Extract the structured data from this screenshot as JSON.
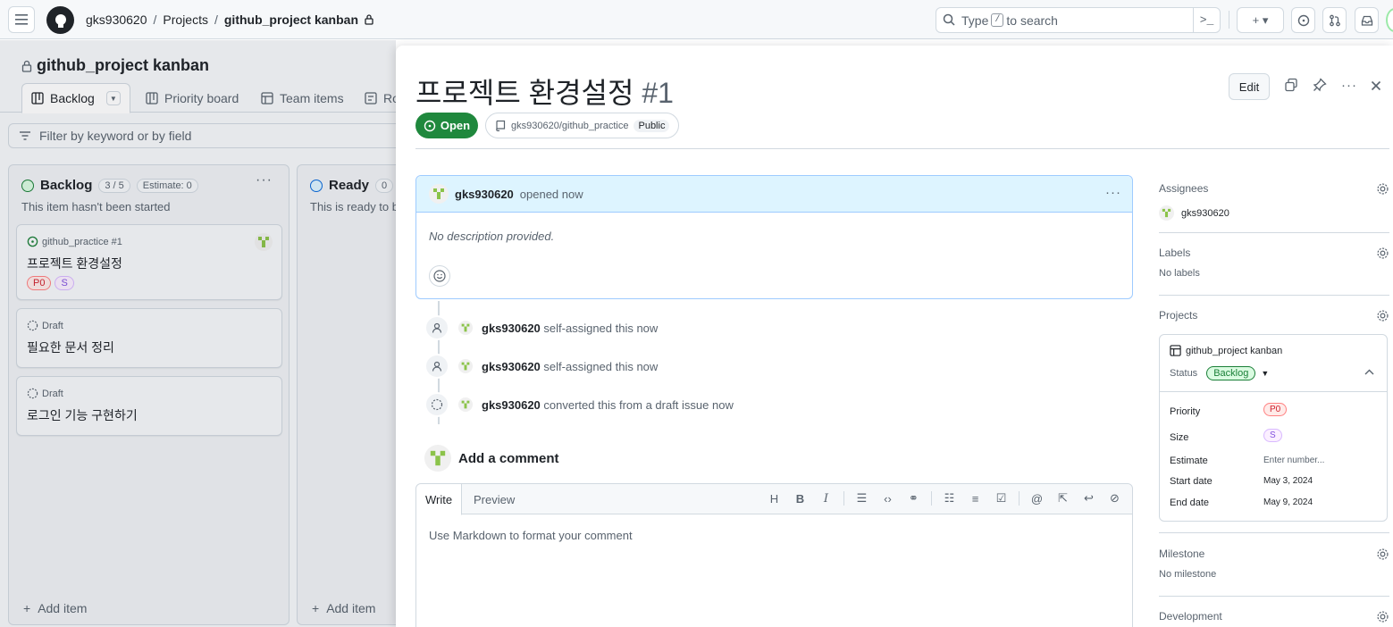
{
  "header": {
    "crumbs": [
      "gks930620",
      "Projects",
      "github_project kanban"
    ],
    "search_prefix": "Type",
    "search_key": "/",
    "search_suffix": "to search",
    "cmd": ">_",
    "plus": "+ ▾"
  },
  "project": {
    "title": "github_project kanban",
    "views": [
      "Backlog",
      "Priority board",
      "Team items",
      "Ro"
    ],
    "filter_placeholder": "Filter by keyword or by field"
  },
  "columns": [
    {
      "name": "Backlog",
      "count": "3 / 5",
      "estimate": "Estimate: 0",
      "desc": "This item hasn't been started",
      "color": "#1a7f37",
      "cards": [
        {
          "meta": "github_practice #1",
          "title": "프로젝트 환경설정",
          "labels": [
            "P0",
            "S"
          ]
        },
        {
          "meta": "Draft",
          "title": "필요한 문서 정리"
        },
        {
          "meta": "Draft",
          "title": "로그인 기능 구현하기"
        }
      ],
      "add_item": "Add item"
    },
    {
      "name": "Ready",
      "count": "0",
      "desc": "This is ready to b",
      "color": "#0969da",
      "add_item": "Add item"
    }
  ],
  "issue": {
    "title": "프로젝트 환경설정",
    "number": "#1",
    "edit": "Edit",
    "state": "Open",
    "repo": "gks930620/github_practice",
    "visibility": "Public",
    "author": "gks930620",
    "opened": "opened now",
    "body": "No description provided.",
    "timeline": [
      {
        "user": "gks930620",
        "text": "self-assigned this now"
      },
      {
        "user": "gks930620",
        "text": "self-assigned this now"
      },
      {
        "user": "gks930620",
        "text": "converted this from a draft issue now"
      }
    ],
    "add_comment": "Add a comment",
    "editor_tabs": [
      "Write",
      "Preview"
    ],
    "editor_placeholder": "Use Markdown to format your comment",
    "tools": [
      "H",
      "B",
      "I"
    ]
  },
  "sidebar": {
    "assignees_h": "Assignees",
    "assignee": "gks930620",
    "labels_h": "Labels",
    "labels_v": "No labels",
    "projects_h": "Projects",
    "proj_name": "github_project kanban",
    "status_k": "Status",
    "status_v": "Backlog",
    "fields": [
      {
        "k": "Priority",
        "v": "P0"
      },
      {
        "k": "Size",
        "v": "S"
      },
      {
        "k": "Estimate",
        "v": "Enter number..."
      },
      {
        "k": "Start date",
        "v": "May 3, 2024"
      },
      {
        "k": "End date",
        "v": "May 9, 2024"
      }
    ],
    "milestone_h": "Milestone",
    "milestone_v": "No milestone",
    "development_h": "Development"
  }
}
